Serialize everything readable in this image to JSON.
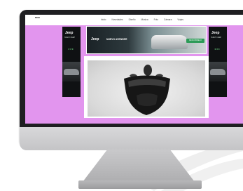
{
  "site": {
    "logo_text": "MCB",
    "nav": [
      "Inicio",
      "Novedades",
      "Diseño",
      "Música",
      "Foto",
      "Cámara",
      "Viajes"
    ]
  },
  "ads": {
    "skyscraper": {
      "brand": "Jeep",
      "tagline": "NUEVO JEEP",
      "stars": "★★★"
    },
    "leaderboard": {
      "brand": "Jeep",
      "headline": "NUEVO AVENGER",
      "cta": "DESCÚBRELO"
    }
  },
  "colors": {
    "page_background": "#e295ee",
    "ad_dark": "#0f1113",
    "cta_green": "#2c9b57"
  },
  "hero": {
    "image": "person-with-black-shield-photo"
  }
}
